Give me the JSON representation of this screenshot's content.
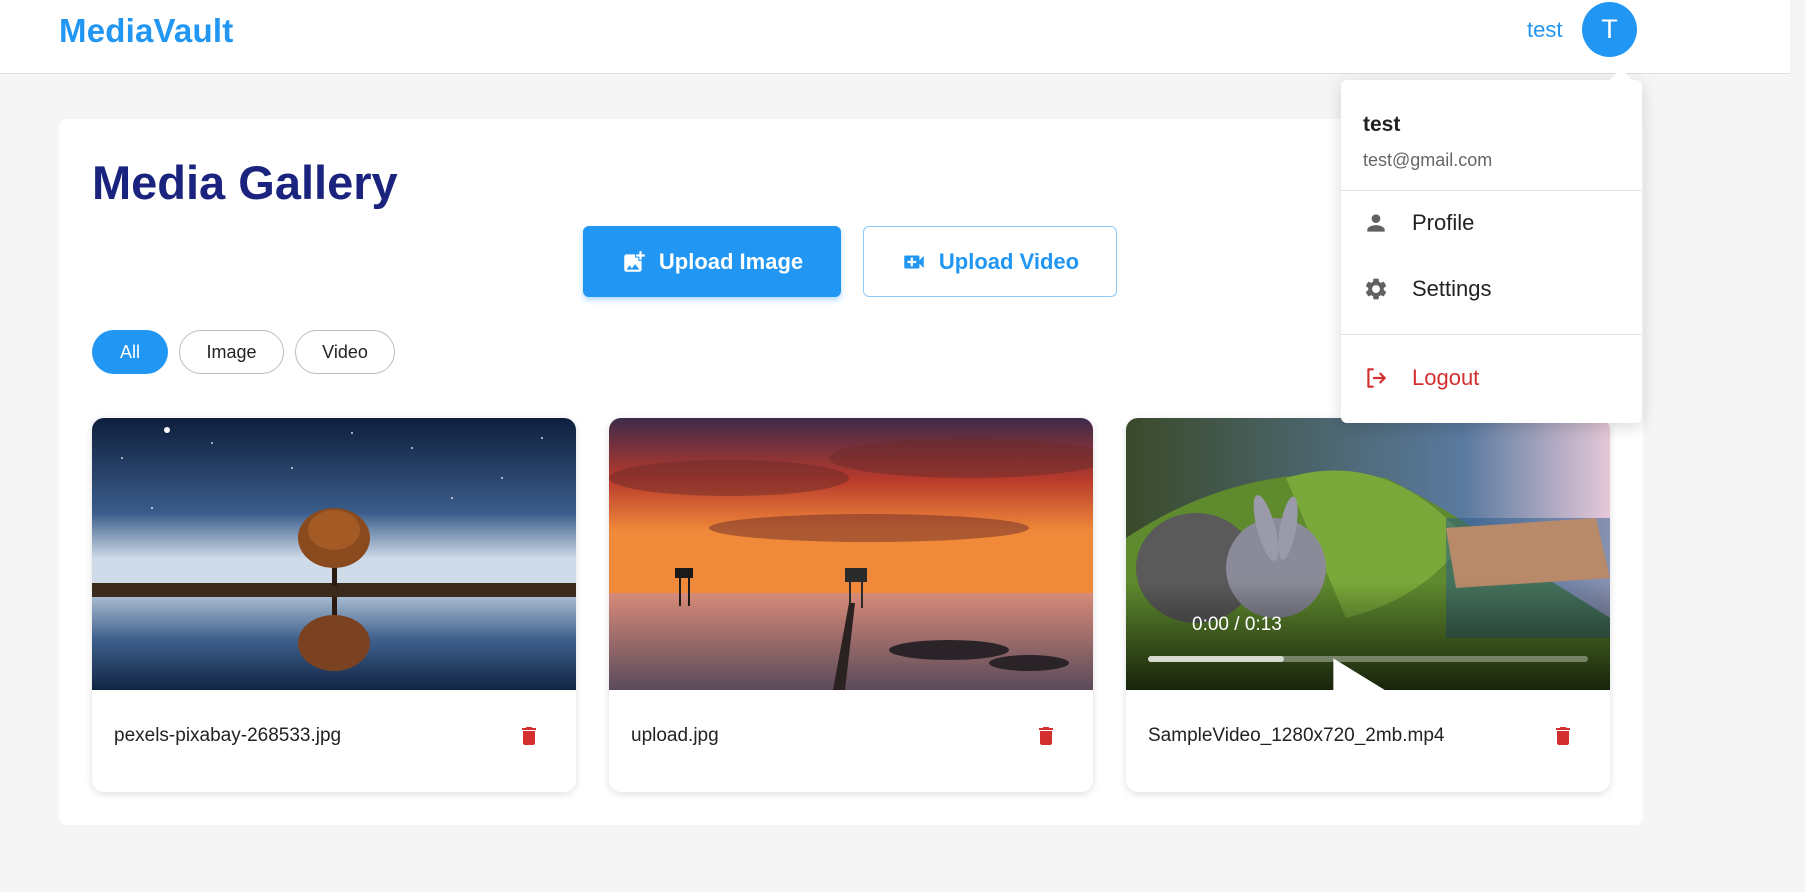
{
  "app": {
    "brand": "MediaVault"
  },
  "header": {
    "username": "test",
    "avatar_initial": "T"
  },
  "page": {
    "title": "Media Gallery"
  },
  "actions": {
    "upload_image": "Upload Image",
    "upload_video": "Upload Video"
  },
  "filters": [
    {
      "label": "All",
      "active": true
    },
    {
      "label": "Image",
      "active": false
    },
    {
      "label": "Video",
      "active": false
    }
  ],
  "media": [
    {
      "filename": "pexels-pixabay-268533.jpg",
      "kind": "image"
    },
    {
      "filename": "upload.jpg",
      "kind": "image"
    },
    {
      "filename": "SampleVideo_1280x720_2mb.mp4",
      "kind": "video",
      "time": "0:00 / 0:13",
      "buffered_fraction": 0.31
    }
  ],
  "menu": {
    "name": "test",
    "email": "test@gmail.com",
    "items": [
      {
        "label": "Profile",
        "icon": "person-icon"
      },
      {
        "label": "Settings",
        "icon": "gear-icon"
      },
      {
        "label": "Logout",
        "icon": "logout-icon"
      }
    ]
  },
  "colors": {
    "primary": "#2196f3",
    "title": "#1a237e",
    "danger": "#d32f2f"
  }
}
